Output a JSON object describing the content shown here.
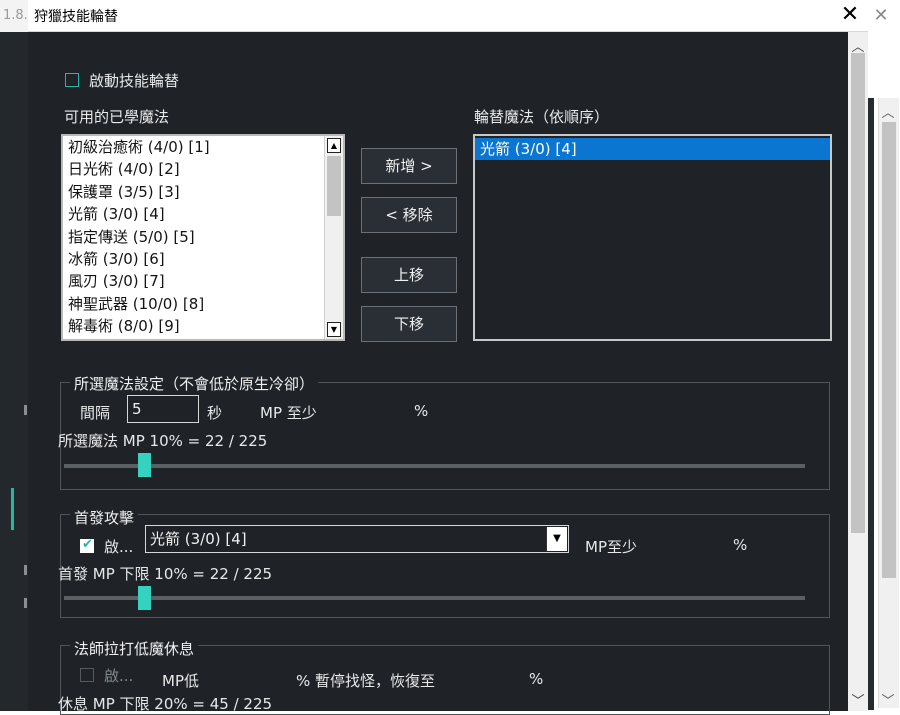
{
  "background_window": {
    "title_fragment": "1.8."
  },
  "dialog": {
    "title": "狩獵技能輪替",
    "enable_rotation": {
      "label": "啟動技能輪替",
      "checked": false
    },
    "available_header": "可用的已學魔法",
    "available_spells": [
      "初級治癒術 (4/0)  [1]",
      "日光術 (4/0)  [2]",
      "保護罩 (3/5)  [3]",
      "光箭 (3/0)  [4]",
      "指定傳送 (5/0)  [5]",
      "冰箭 (3/0)  [6]",
      "風刃 (3/0)  [7]",
      "神聖武器 (10/0)  [8]",
      "解毒術 (8/0)  [9]"
    ],
    "buttons": {
      "add": "新增 >",
      "remove": "< 移除",
      "up": "上移",
      "down": "下移"
    },
    "rotation_header": "輪替魔法（依順序）",
    "rotation_spells": [
      "光箭 (3/0)  [4]"
    ],
    "selected_settings": {
      "title": "所選魔法設定（不會低於原生冷卻）",
      "interval_label": "間隔",
      "interval_value": "5",
      "seconds_label": "秒",
      "mp_min_label": "MP 至少",
      "percent": "%",
      "mp_readout": "所選魔法 MP  10% = 22 / 225",
      "slider_percent": 10
    },
    "first_attack": {
      "title": "首發攻擊",
      "enable_label": "啟...",
      "enabled": true,
      "spell": "光箭 (3/0)  [4]",
      "mp_min_label": "MP至少",
      "percent": "%",
      "mp_readout": "首發 MP 下限  10% = 22 / 225",
      "slider_percent": 10
    },
    "mage_rest": {
      "title": "法師拉打低魔休息",
      "enable_label": "啟...",
      "enabled": false,
      "mp_low_label": "MP低",
      "pause_label": "% 暫停找怪，恢復至",
      "percent": "%",
      "mp_readout": "休息 MP 下限  20% = 45 / 225"
    }
  }
}
